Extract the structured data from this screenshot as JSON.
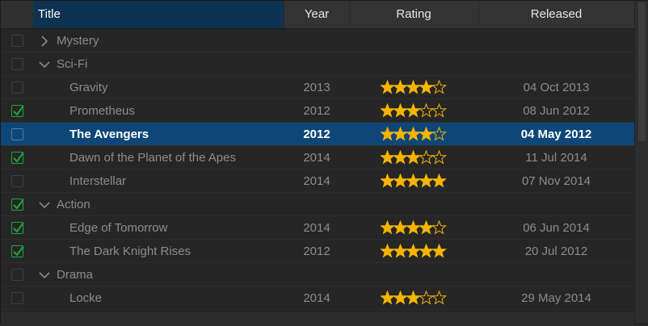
{
  "columns": {
    "title": "Title",
    "year": "Year",
    "rating": "Rating",
    "released": "Released"
  },
  "colors": {
    "star_fill": "#f5b400",
    "check": "#1fa53a",
    "selection": "#0e4777",
    "header_active": "#0e3352"
  },
  "rows": [
    {
      "type": "group",
      "label": "Mystery",
      "expanded": false,
      "checked": false
    },
    {
      "type": "group",
      "label": "Sci-Fi",
      "expanded": true,
      "checked": false
    },
    {
      "type": "item",
      "title": "Gravity",
      "year": "2013",
      "rating": 4,
      "released": "04 Oct 2013",
      "checked": false,
      "selected": false
    },
    {
      "type": "item",
      "title": "Prometheus",
      "year": "2012",
      "rating": 3,
      "released": "08 Jun 2012",
      "checked": true,
      "selected": false
    },
    {
      "type": "item",
      "title": "The Avengers",
      "year": "2012",
      "rating": 4,
      "released": "04 May 2012",
      "checked": false,
      "selected": true
    },
    {
      "type": "item",
      "title": "Dawn of the Planet of the Apes",
      "year": "2014",
      "rating": 3,
      "released": "11 Jul 2014",
      "checked": true,
      "selected": false
    },
    {
      "type": "item",
      "title": "Interstellar",
      "year": "2014",
      "rating": 5,
      "released": "07 Nov 2014",
      "checked": false,
      "selected": false
    },
    {
      "type": "group",
      "label": "Action",
      "expanded": true,
      "checked": true
    },
    {
      "type": "item",
      "title": "Edge of Tomorrow",
      "year": "2014",
      "rating": 4,
      "released": "06 Jun 2014",
      "checked": true,
      "selected": false
    },
    {
      "type": "item",
      "title": "The Dark Knight Rises",
      "year": "2012",
      "rating": 5,
      "released": "20 Jul 2012",
      "checked": true,
      "selected": false
    },
    {
      "type": "group",
      "label": "Drama",
      "expanded": true,
      "checked": false
    },
    {
      "type": "item",
      "title": "Locke",
      "year": "2014",
      "rating": 3,
      "released": "29 May 2014",
      "checked": false,
      "selected": false
    }
  ]
}
